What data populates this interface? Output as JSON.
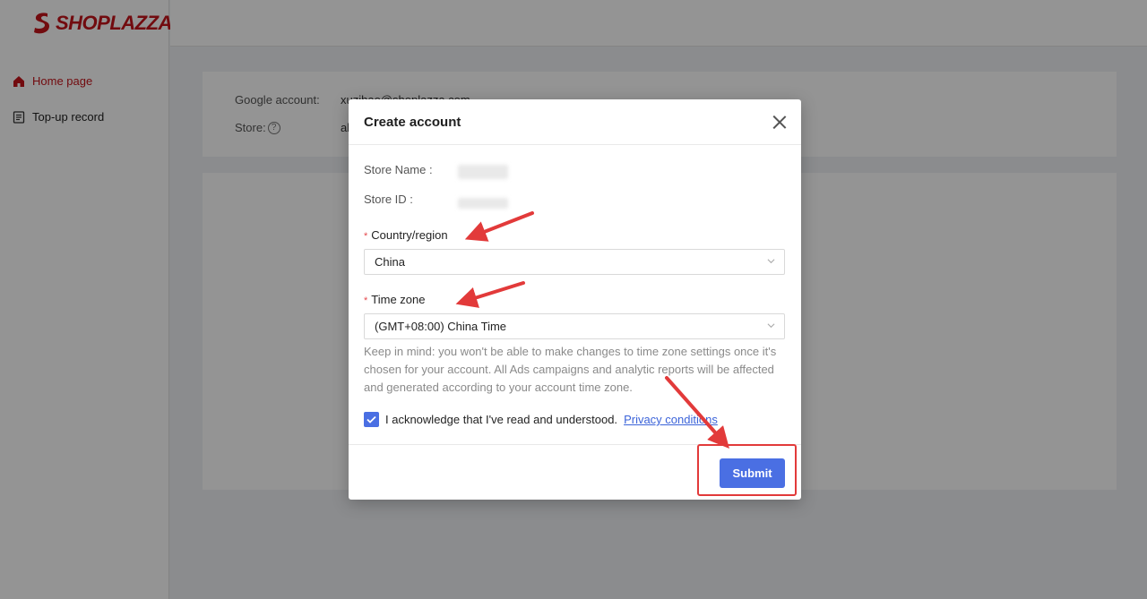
{
  "brand": {
    "name": "SHOPLAZZA",
    "color": "#c4141b"
  },
  "sidebar": {
    "items": [
      {
        "label": "Home page",
        "icon": "home-icon",
        "active": true
      },
      {
        "label": "Top-up record",
        "icon": "document-list-icon",
        "active": false
      }
    ]
  },
  "account_card": {
    "google_account_label": "Google account:",
    "google_account_value": "xuzihao@shoplazza.com",
    "store_label": "Store:",
    "store_value": "al",
    "help_icon": "question-circle-icon"
  },
  "modal": {
    "title": "Create account",
    "store_name_label": "Store Name :",
    "store_id_label": "Store ID :",
    "country": {
      "required_mark": "*",
      "label": "Country/region",
      "value": "China"
    },
    "timezone": {
      "required_mark": "*",
      "label": "Time zone",
      "value": "(GMT+08:00) China Time"
    },
    "hint": "Keep in mind: you won't be able to make changes to time zone settings once it's chosen for your account. All Ads campaigns and analytic reports will be affected and generated according to your account time zone.",
    "ack_text": "I acknowledge that I've read and understood.",
    "ack_checked": true,
    "privacy_link": "Privacy conditions",
    "submit_label": "Submit"
  },
  "colors": {
    "primary": "#4a6fe3",
    "annotation_red": "#e23a3a"
  }
}
